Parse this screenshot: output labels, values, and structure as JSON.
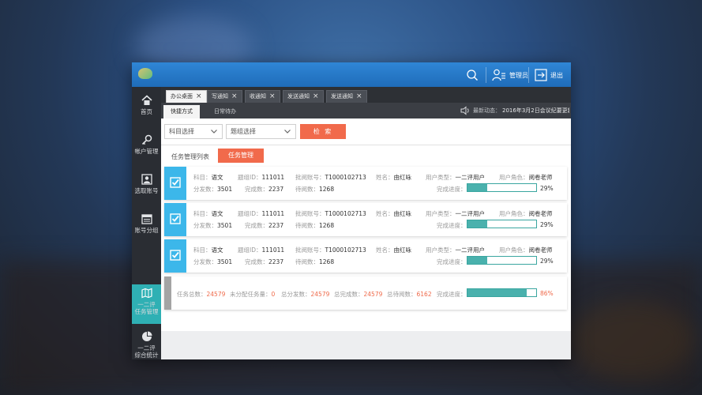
{
  "titlebar": {
    "admin_label": "管理员",
    "exit_label": "退出"
  },
  "sidebar": {
    "items": [
      {
        "label": "首页",
        "icon": "home-icon"
      },
      {
        "label": "帐户管理",
        "icon": "key-icon"
      },
      {
        "label": "选取账号",
        "icon": "contact-card-icon"
      },
      {
        "label": "账号分组",
        "icon": "calendar-list-icon"
      },
      {
        "label": "一二评",
        "label2": "任务管理",
        "icon": "map-icon",
        "active": true
      },
      {
        "label": "一二评",
        "label2": "综合统计",
        "icon": "pie-chart-icon"
      }
    ]
  },
  "tabs": [
    {
      "label": "办公桌面",
      "active": true
    },
    {
      "label": "写通知"
    },
    {
      "label": "收通知"
    },
    {
      "label": "发送通知"
    },
    {
      "label": "发送通知"
    }
  ],
  "subtabs": [
    {
      "label": "快捷方式",
      "active": true
    },
    {
      "label": "日常待办"
    }
  ],
  "news": {
    "label": "最新动态：",
    "text": "2016年3月2日会议纪要更新..."
  },
  "filters": {
    "subject_select": "科目选择",
    "group_select": "题组选择",
    "search_button": "检 索"
  },
  "list": {
    "title": "任务管理列表",
    "button": "任务管理"
  },
  "tasks": [
    {
      "subject_label": "科目：",
      "subject": "语文",
      "group_label": "题组ID：",
      "group_id": "111011",
      "account_label": "批阅账号：",
      "account": "T1000102713",
      "name_label": "姓名：",
      "name": "由红咏",
      "user_type_label": "用户类型：",
      "user_type": "一二评用户",
      "role_label": "用户角色：",
      "role": "阅卷老师",
      "sent_label": "分发数：",
      "sent": "3501",
      "done_label": "完成数：",
      "done": "2237",
      "pending_label": "待阅数：",
      "pending": "1268",
      "progress_label": "完成进度：",
      "progress": 29,
      "progress_text": "29%"
    },
    {
      "subject_label": "科目：",
      "subject": "语文",
      "group_label": "题组ID：",
      "group_id": "111011",
      "account_label": "批阅账号：",
      "account": "T1000102713",
      "name_label": "姓名：",
      "name": "由红咏",
      "user_type_label": "用户类型：",
      "user_type": "一二评用户",
      "role_label": "用户角色：",
      "role": "阅卷老师",
      "sent_label": "分发数：",
      "sent": "3501",
      "done_label": "完成数：",
      "done": "2237",
      "pending_label": "待阅数：",
      "pending": "1268",
      "progress_label": "完成进度：",
      "progress": 29,
      "progress_text": "29%"
    },
    {
      "subject_label": "科目：",
      "subject": "语文",
      "group_label": "题组ID：",
      "group_id": "111011",
      "account_label": "批阅账号：",
      "account": "T1000102713",
      "name_label": "姓名：",
      "name": "由红咏",
      "user_type_label": "用户类型：",
      "user_type": "一二评用户",
      "role_label": "用户角色：",
      "role": "阅卷老师",
      "sent_label": "分发数：",
      "sent": "3501",
      "done_label": "完成数：",
      "done": "2237",
      "pending_label": "待阅数：",
      "pending": "1268",
      "progress_label": "完成进度：",
      "progress": 29,
      "progress_text": "29%"
    }
  ],
  "summary": {
    "total_tasks_label": "任务总数：",
    "total_tasks": "24579",
    "unassigned_label": "未分配任务量：",
    "unassigned": "0",
    "total_sent_label": "总分发数：",
    "total_sent": "24579",
    "total_done_label": "总完成数：",
    "total_done": "24579",
    "total_pending_label": "总待阅数：",
    "total_pending": "6162",
    "progress_label": "完成进度：",
    "progress": 86,
    "progress_text": "86%"
  },
  "colors": {
    "accent_orange": "#f16a4b",
    "teal": "#2fb0b4",
    "check_blue": "#3cb7ea",
    "titlebar_blue": "#2677c8"
  }
}
